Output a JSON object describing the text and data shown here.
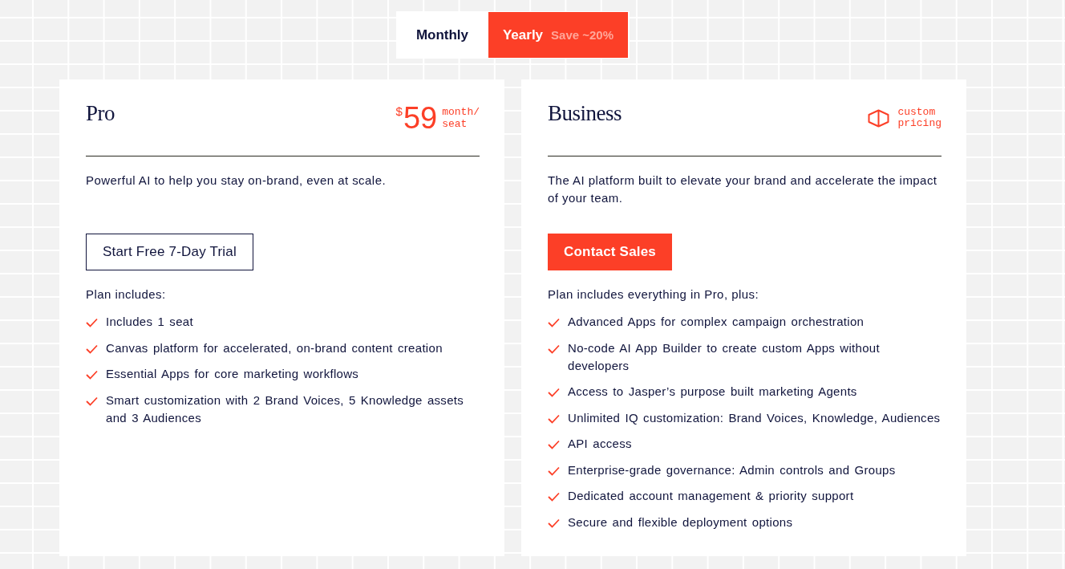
{
  "billing_toggle": {
    "options": [
      {
        "label": "Monthly",
        "selected": false
      },
      {
        "label": "Yearly",
        "note": "Save ~20%",
        "selected": true
      }
    ]
  },
  "plans": [
    {
      "name": "Pro",
      "price": {
        "kind": "amount",
        "currency": "$",
        "amount": "59",
        "unit": "month/ seat"
      },
      "description": "Powerful AI to help you stay on-brand, even at scale.",
      "button": {
        "kind": "outline",
        "label": "Start Free 7-Day Trial"
      },
      "includes_label": "Plan includes:",
      "features": [
        "Includes 1 seat",
        "Canvas platform for accelerated, on-brand content creation",
        "Essential Apps for core marketing workflows",
        "Smart customization with 2 Brand Voices, 5 Knowledge assets and 3 Audiences"
      ]
    },
    {
      "name": "Business",
      "price": {
        "kind": "custom",
        "label": "custom pricing"
      },
      "description": "The AI platform built to elevate your brand and accelerate the impact of your team.",
      "button": {
        "kind": "filled",
        "label": "Contact Sales"
      },
      "includes_label": "Plan includes everything in Pro, plus:",
      "features": [
        "Advanced Apps for complex campaign orchestration",
        "No-code AI App Builder to create custom Apps without developers",
        "Access to Jasper’s purpose built marketing Agents",
        "Unlimited IQ customization: Brand Voices, Knowledge, Audiences",
        "API access",
        "Enterprise-grade governance: Admin controls and Groups",
        "Dedicated account management & priority support",
        "Secure and flexible deployment options"
      ]
    }
  ]
}
